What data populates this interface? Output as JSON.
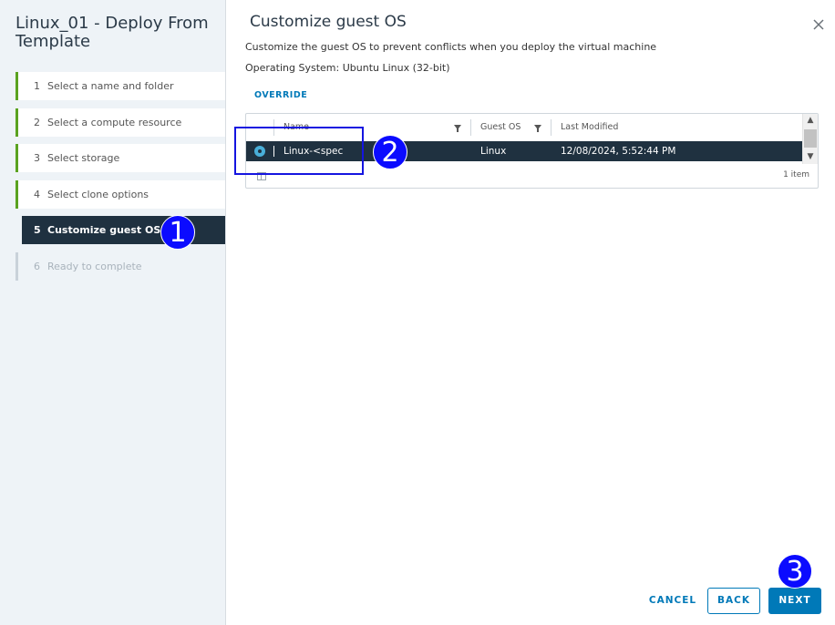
{
  "wizard": {
    "title": "Linux_01 - Deploy From Template",
    "steps": [
      {
        "num": "1",
        "label": "Select a name and folder"
      },
      {
        "num": "2",
        "label": "Select a compute resource"
      },
      {
        "num": "3",
        "label": "Select storage"
      },
      {
        "num": "4",
        "label": "Select clone options"
      },
      {
        "num": "5",
        "label": "Customize guest OS"
      },
      {
        "num": "6",
        "label": "Ready to complete"
      }
    ]
  },
  "main": {
    "title": "Customize guest OS",
    "description": "Customize the guest OS to prevent conflicts when you deploy the virtual machine",
    "os_line": "Operating System: Ubuntu Linux (32-bit)",
    "override_label": "OVERRIDE"
  },
  "grid": {
    "columns": [
      "Name",
      "Guest OS",
      "Last Modified"
    ],
    "rows": [
      {
        "name": "Linux-<spec",
        "guest_os": "Linux",
        "last_modified": "12/08/2024, 5:52:44 PM"
      }
    ],
    "footer_count": "1 item"
  },
  "buttons": {
    "cancel": "CANCEL",
    "back": "BACK",
    "next": "NEXT"
  },
  "annotations": {
    "badge1": "1",
    "badge2": "2",
    "badge3": "3"
  },
  "colors": {
    "accent": "#0079b8",
    "selected_row": "#1f3140",
    "step_done": "#5aa220",
    "annotation": "#0b0bff"
  }
}
